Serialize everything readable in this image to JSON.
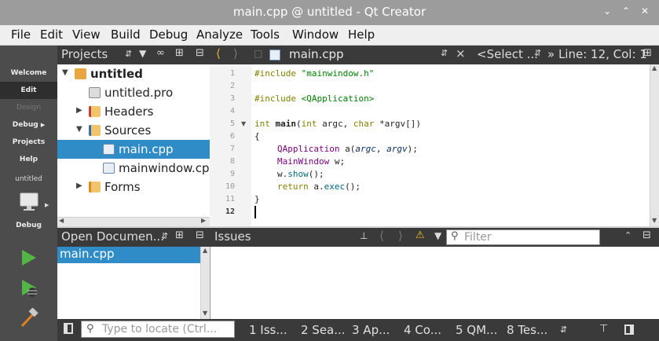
{
  "window": {
    "title": "main.cpp @ untitled - Qt Creator",
    "minimize": "⌄",
    "maximize": "⌃",
    "close": "✕"
  },
  "menu": [
    "File",
    "Edit",
    "View",
    "Build",
    "Debug",
    "Analyze",
    "Tools",
    "Window",
    "Help"
  ],
  "modes": {
    "welcome": "Welcome",
    "edit": "Edit",
    "design": "Design",
    "debug": "Debug",
    "projects": "Projects",
    "help": "Help",
    "target_name": "untitled",
    "target_config": "Debug"
  },
  "projects_panel": {
    "title": "Projects",
    "tree": [
      {
        "label": "untitled",
        "level": 0,
        "expanded": true,
        "bold": true,
        "icon": "project-icon"
      },
      {
        "label": "untitled.pro",
        "level": 1,
        "icon": "pro-file-icon"
      },
      {
        "label": "Headers",
        "level": 1,
        "expanded": false,
        "icon": "headers-folder-icon"
      },
      {
        "label": "Sources",
        "level": 1,
        "expanded": true,
        "icon": "sources-folder-icon"
      },
      {
        "label": "main.cpp",
        "level": 2,
        "selected": true,
        "icon": "cpp-file-icon"
      },
      {
        "label": "mainwindow.cpp",
        "level": 2,
        "icon": "cpp-file-icon"
      },
      {
        "label": "Forms",
        "level": 1,
        "expanded": false,
        "icon": "forms-folder-icon"
      }
    ]
  },
  "editor": {
    "file_tab": "main.cpp",
    "symbol_select": "<Select ...",
    "position": "» Line: 12, Col: 1",
    "current_line": 12,
    "lines": [
      "1",
      "2",
      "3",
      "4",
      "5",
      "6",
      "7",
      "8",
      "9",
      "10",
      "11",
      "12"
    ],
    "code": {
      "l1_directive": "#include ",
      "l1_header": "\"mainwindow.h\"",
      "l3_directive": "#include ",
      "l3_header": "<QApplication>",
      "l5_int": "int ",
      "l5_main": "main",
      "l5_paren": "(",
      "l5_int2": "int ",
      "l5_argc": "argc",
      "l5_comma": ", ",
      "l5_char": "char ",
      "l5_argv": "*argv[])",
      "l6": "{",
      "l7_type": "QApplication ",
      "l7_var": "a(",
      "l7_argc": "argc",
      "l7_sep": ", ",
      "l7_argv": "argv",
      "l7_end": ");",
      "l8_type": "MainWindow ",
      "l8_var": "w;",
      "l9_obj": "w.",
      "l9_call": "show",
      "l9_end": "();",
      "l10_return": "return ",
      "l10_obj": "a.",
      "l10_call": "exec",
      "l10_end": "();",
      "l11": "}"
    }
  },
  "open_documents": {
    "title": "Open Documen...",
    "items": [
      "main.cpp"
    ]
  },
  "issues": {
    "title": "Issues",
    "filter_placeholder": "Filter"
  },
  "status": {
    "locate_placeholder": "Type to locate (Ctrl...",
    "panes": [
      "1 Iss...",
      "2 Sea...",
      "3 Ap...",
      "4 Co...",
      "5 QM...",
      "8 Tes..."
    ]
  },
  "colors": {
    "selection": "#308cc6",
    "mode_bar": "#4c4c4c",
    "run_green": "#53b546",
    "build_orange": "#e08020"
  }
}
